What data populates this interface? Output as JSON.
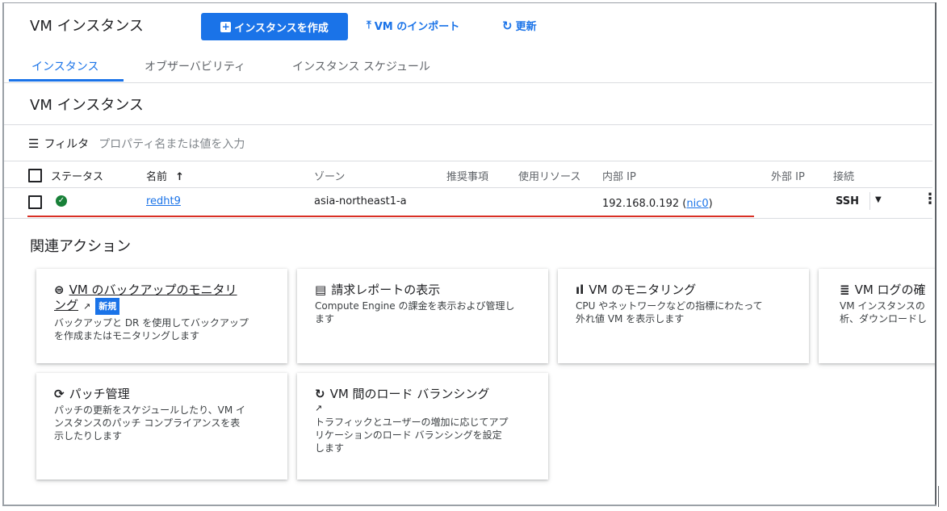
{
  "header": {
    "title": "VM インスタンス",
    "create_button": "インスタンスを作成",
    "import_button": "VM のインポート",
    "refresh_button": "更新"
  },
  "tabs": [
    {
      "label": "インスタンス",
      "active": true
    },
    {
      "label": "オブザーバビリティ",
      "active": false
    },
    {
      "label": "インスタンス スケジュール",
      "active": false
    }
  ],
  "section_title": "VM インスタンス",
  "filter": {
    "label": "フィルタ",
    "placeholder": "プロパティ名または値を入力"
  },
  "table": {
    "columns": {
      "status": "ステータス",
      "name": "名前",
      "zone": "ゾーン",
      "recommendation": "推奨事項",
      "in_use": "使用リソース",
      "internal_ip": "内部 IP",
      "external_ip": "外部 IP",
      "connect": "接続"
    },
    "rows": [
      {
        "name": "redht9",
        "zone": "asia-northeast1-a",
        "internal_ip": "192.168.0.192",
        "nic": "nic0",
        "connect": "SSH"
      }
    ]
  },
  "related": {
    "title": "関連アクション",
    "cards": [
      {
        "title_line1": "VM のバックアップのモニタリ",
        "title_line2": "ング",
        "badge": "新規",
        "desc_line1": "バックアップと DR を使用してバックアップ",
        "desc_line2": "を作成またはモニタリングします"
      },
      {
        "title": "請求レポートの表示",
        "desc_line1": "Compute Engine の課金を表示および管理し",
        "desc_line2": "ます"
      },
      {
        "title": "VM のモニタリング",
        "desc_line1": "CPU やネットワークなどの指標にわたって",
        "desc_line2": "外れ値 VM を表示します"
      },
      {
        "title": "VM ログの確",
        "desc_line1": "VM インスタンスの",
        "desc_line2": "析、ダウンロードし"
      },
      {
        "title": "パッチ管理",
        "desc_line1": "パッチの更新をスケジュールしたり、VM イ",
        "desc_line2": "ンスタンスのパッチ コンプライアンスを表",
        "desc_line3": "示したりします"
      },
      {
        "title": "VM 間のロード バランシング",
        "desc_line1": "トラフィックとユーザーの増加に応じてアプ",
        "desc_line2": "リケーションのロード バランシングを設定",
        "desc_line3": "します"
      }
    ]
  },
  "colors": {
    "primary": "#1a73e8",
    "success": "#188038",
    "highlight": "#d93025"
  }
}
